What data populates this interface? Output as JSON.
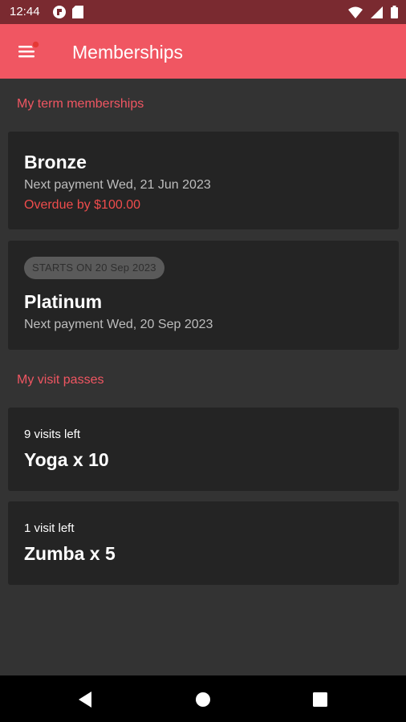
{
  "status_bar": {
    "time": "12:44",
    "icons": [
      "app-notification-icon",
      "sd-card-icon",
      "wifi-icon",
      "cell-signal-icon",
      "battery-icon"
    ]
  },
  "app_bar": {
    "title": "Memberships",
    "menu_icon": "menu-icon",
    "notification_dot_color": "#e53935"
  },
  "term_memberships": {
    "section_title": "My term memberships",
    "items": [
      {
        "name": "Bronze",
        "next_payment": "Next payment Wed, 21 Jun 2023",
        "overdue": "Overdue by $100.00"
      },
      {
        "badge": "STARTS ON 20 Sep 2023",
        "name": "Platinum",
        "next_payment": "Next payment Wed, 20 Sep 2023"
      }
    ]
  },
  "visit_passes": {
    "section_title": "My visit passes",
    "items": [
      {
        "visits_left": "9 visits left",
        "name": "Yoga x 10"
      },
      {
        "visits_left": "1 visit left",
        "name": "Zumba x 5"
      }
    ]
  },
  "nav_bar": {
    "icons": [
      "back-icon",
      "home-icon",
      "recents-icon"
    ]
  },
  "colors": {
    "accent": "#f05662",
    "status_bar": "#7a2a30",
    "background": "#333333",
    "card": "#242424",
    "overdue": "#ef4c4c"
  }
}
